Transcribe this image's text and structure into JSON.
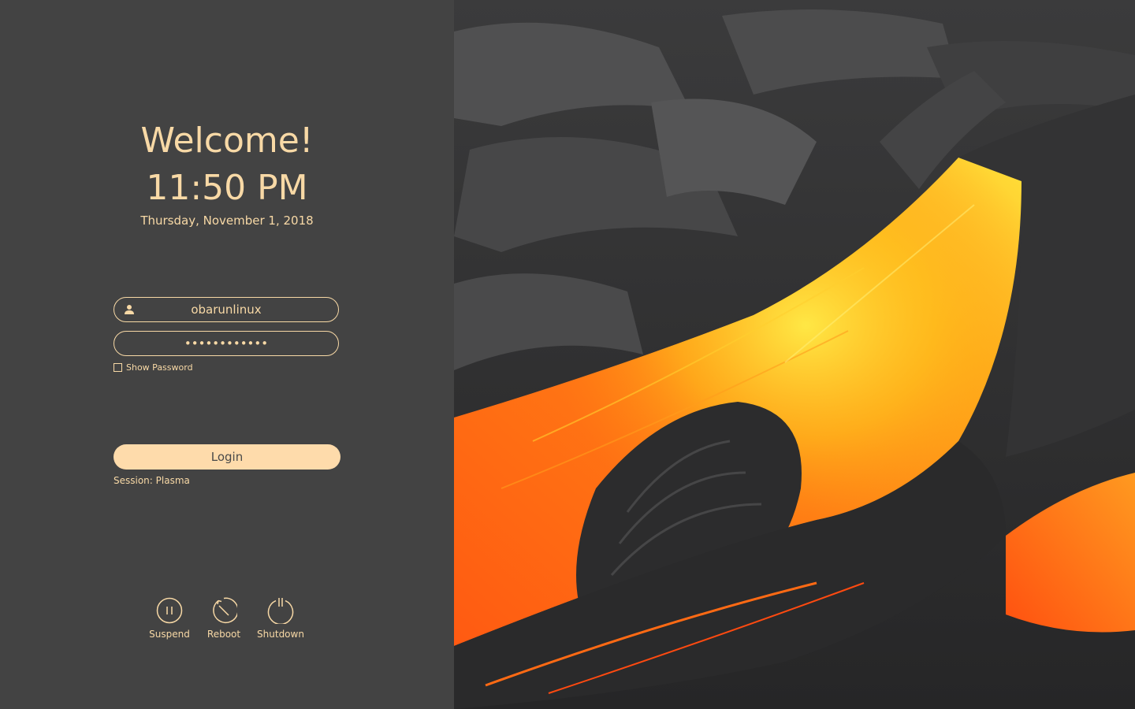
{
  "greeting": {
    "welcome": "Welcome!",
    "time": "11:50 PM",
    "date": "Thursday, November 1, 2018"
  },
  "login_form": {
    "username_value": "obarunlinux",
    "password_value": "••••••••••••",
    "show_password_label": "Show Password",
    "show_password_checked": false,
    "login_label": "Login",
    "session_text": "Session: Plasma"
  },
  "power_actions": [
    {
      "label": "Suspend",
      "icon": "suspend-icon"
    },
    {
      "label": "Reboot",
      "icon": "reboot-icon"
    },
    {
      "label": "Shutdown",
      "icon": "shutdown-icon"
    }
  ],
  "colors": {
    "panel_background": "#434343",
    "accent": "#f8d9a6",
    "login_button": "#fedbab"
  },
  "background": "lava-flow-wallpaper"
}
